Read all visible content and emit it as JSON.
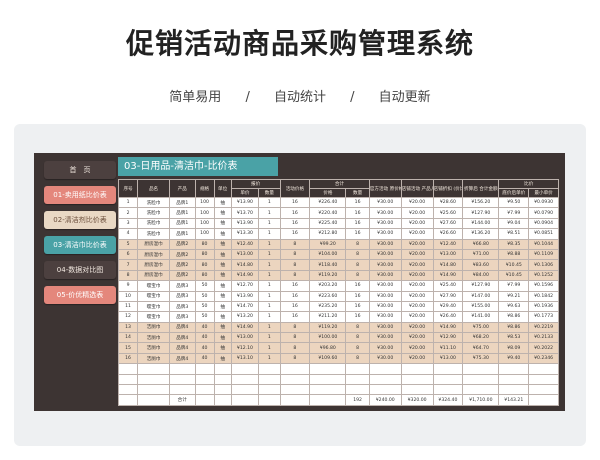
{
  "banner": {
    "title": "促销活动商品采购管理系统",
    "tags": [
      "简单易用",
      "/",
      "自动统计",
      "/",
      "自动更新"
    ]
  },
  "sidebar": {
    "items": [
      {
        "label": "首　页"
      },
      {
        "label": "01-卖用纸比价表"
      },
      {
        "label": "02-清洁剂比价表"
      },
      {
        "label": "03-清洁巾比价表"
      },
      {
        "label": "04-数据对比图"
      },
      {
        "label": "05-价优精选表"
      }
    ]
  },
  "sheet": {
    "title": "03-日用品-清洁巾-比价表",
    "headers": {
      "seq": "序号",
      "name": "品名",
      "product": "产品",
      "spec": "规格",
      "unit": "单位",
      "quote_group": "报价",
      "unit_price": "单价",
      "qty": "数量",
      "activity_price": "活动价格",
      "total_group": "合计",
      "price": "价格",
      "count": "数量",
      "supplier_sale": "官方活动\n原价格(元)",
      "store_sale": "店铺活动\n产品入库价",
      "store_disc": "店铺折扣\n(价比1.5/元)",
      "after_disc": "折算后\n合计金额",
      "compare_group": "比价",
      "lowest_unit": "底价后单价",
      "min_unit": "最小单价"
    },
    "rows": [
      [
        "1",
        "洗脸巾",
        "品牌1",
        "100",
        "抽",
        "¥13.90",
        "1",
        "16",
        "¥226.40",
        "16",
        "¥30.00",
        "¥20.00",
        "¥28.60",
        "¥156.20",
        "¥9.50",
        "¥0.0930"
      ],
      [
        "2",
        "洗脸巾",
        "品牌1",
        "100",
        "抽",
        "¥13.70",
        "1",
        "16",
        "¥220.40",
        "16",
        "¥30.00",
        "¥20.00",
        "¥25.60",
        "¥127.90",
        "¥7.99",
        "¥0.0790"
      ],
      [
        "3",
        "洗脸巾",
        "品牌1",
        "100",
        "抽",
        "¥13.90",
        "1",
        "16",
        "¥225.40",
        "16",
        "¥30.00",
        "¥20.00",
        "¥27.60",
        "¥144.00",
        "¥9.04",
        "¥0.0904"
      ],
      [
        "4",
        "洗脸巾",
        "品牌1",
        "100",
        "抽",
        "¥13.30",
        "1",
        "16",
        "¥212.80",
        "16",
        "¥30.00",
        "¥20.00",
        "¥26.60",
        "¥136.20",
        "¥8.51",
        "¥0.0851"
      ],
      [
        "5",
        "厨房湿巾",
        "品牌2",
        "80",
        "抽",
        "¥12.40",
        "1",
        "8",
        "¥99.20",
        "8",
        "¥30.00",
        "¥20.00",
        "¥12.40",
        "¥66.80",
        "¥8.35",
        "¥0.1044"
      ],
      [
        "6",
        "厨房湿巾",
        "品牌2",
        "80",
        "抽",
        "¥13.00",
        "1",
        "8",
        "¥104.00",
        "8",
        "¥30.00",
        "¥20.00",
        "¥13.00",
        "¥71.00",
        "¥8.88",
        "¥0.1109"
      ],
      [
        "7",
        "厨房湿巾",
        "品牌2",
        "80",
        "抽",
        "¥14.80",
        "1",
        "8",
        "¥118.40",
        "8",
        "¥30.00",
        "¥20.00",
        "¥14.80",
        "¥83.60",
        "¥10.45",
        "¥0.1306"
      ],
      [
        "8",
        "厨房湿巾",
        "品牌2",
        "80",
        "抽",
        "¥14.90",
        "1",
        "8",
        "¥119.20",
        "8",
        "¥30.00",
        "¥20.00",
        "¥14.90",
        "¥84.00",
        "¥10.45",
        "¥0.1252"
      ],
      [
        "9",
        "嘤宝巾",
        "品牌3",
        "50",
        "抽",
        "¥12.70",
        "1",
        "16",
        "¥203.20",
        "16",
        "¥30.00",
        "¥20.00",
        "¥25.40",
        "¥127.90",
        "¥7.99",
        "¥0.1596"
      ],
      [
        "10",
        "嘤宝巾",
        "品牌3",
        "50",
        "抽",
        "¥13.90",
        "1",
        "16",
        "¥223.60",
        "16",
        "¥30.00",
        "¥20.00",
        "¥27.90",
        "¥147.00",
        "¥9.21",
        "¥0.1842"
      ],
      [
        "11",
        "嘤宝巾",
        "品牌3",
        "50",
        "抽",
        "¥14.70",
        "1",
        "16",
        "¥235.20",
        "16",
        "¥30.00",
        "¥20.00",
        "¥29.40",
        "¥155.00",
        "¥9.63",
        "¥0.1936"
      ],
      [
        "12",
        "嘤宝巾",
        "品牌3",
        "50",
        "抽",
        "¥13.20",
        "1",
        "16",
        "¥211.20",
        "16",
        "¥30.00",
        "¥20.00",
        "¥26.40",
        "¥141.00",
        "¥8.86",
        "¥0.1773"
      ],
      [
        "13",
        "洁厕巾",
        "品牌4",
        "40",
        "抽",
        "¥14.90",
        "1",
        "8",
        "¥119.20",
        "8",
        "¥30.00",
        "¥20.00",
        "¥14.90",
        "¥75.00",
        "¥8.86",
        "¥0.2219"
      ],
      [
        "14",
        "洁厕巾",
        "品牌4",
        "40",
        "抽",
        "¥13.00",
        "1",
        "8",
        "¥100.00",
        "8",
        "¥30.00",
        "¥20.00",
        "¥12.90",
        "¥68.20",
        "¥8.53",
        "¥0.2133"
      ],
      [
        "15",
        "洁厕巾",
        "品牌4",
        "40",
        "抽",
        "¥12.10",
        "1",
        "8",
        "¥96.80",
        "8",
        "¥30.00",
        "¥20.00",
        "¥11.10",
        "¥64.70",
        "¥8.09",
        "¥0.2022"
      ],
      [
        "16",
        "洁厕巾",
        "品牌4",
        "40",
        "抽",
        "¥13.10",
        "1",
        "8",
        "¥109.60",
        "8",
        "¥30.00",
        "¥20.00",
        "¥13.00",
        "¥75.30",
        "¥9.40",
        "¥0.2346"
      ]
    ],
    "total": {
      "label": "合计",
      "count": "192",
      "supplier_sale": "¥240.00",
      "store_sale": "¥320.00",
      "store_disc": "¥324.40",
      "after_disc": "¥1,710.00",
      "lowest_unit": "¥143.21"
    }
  }
}
